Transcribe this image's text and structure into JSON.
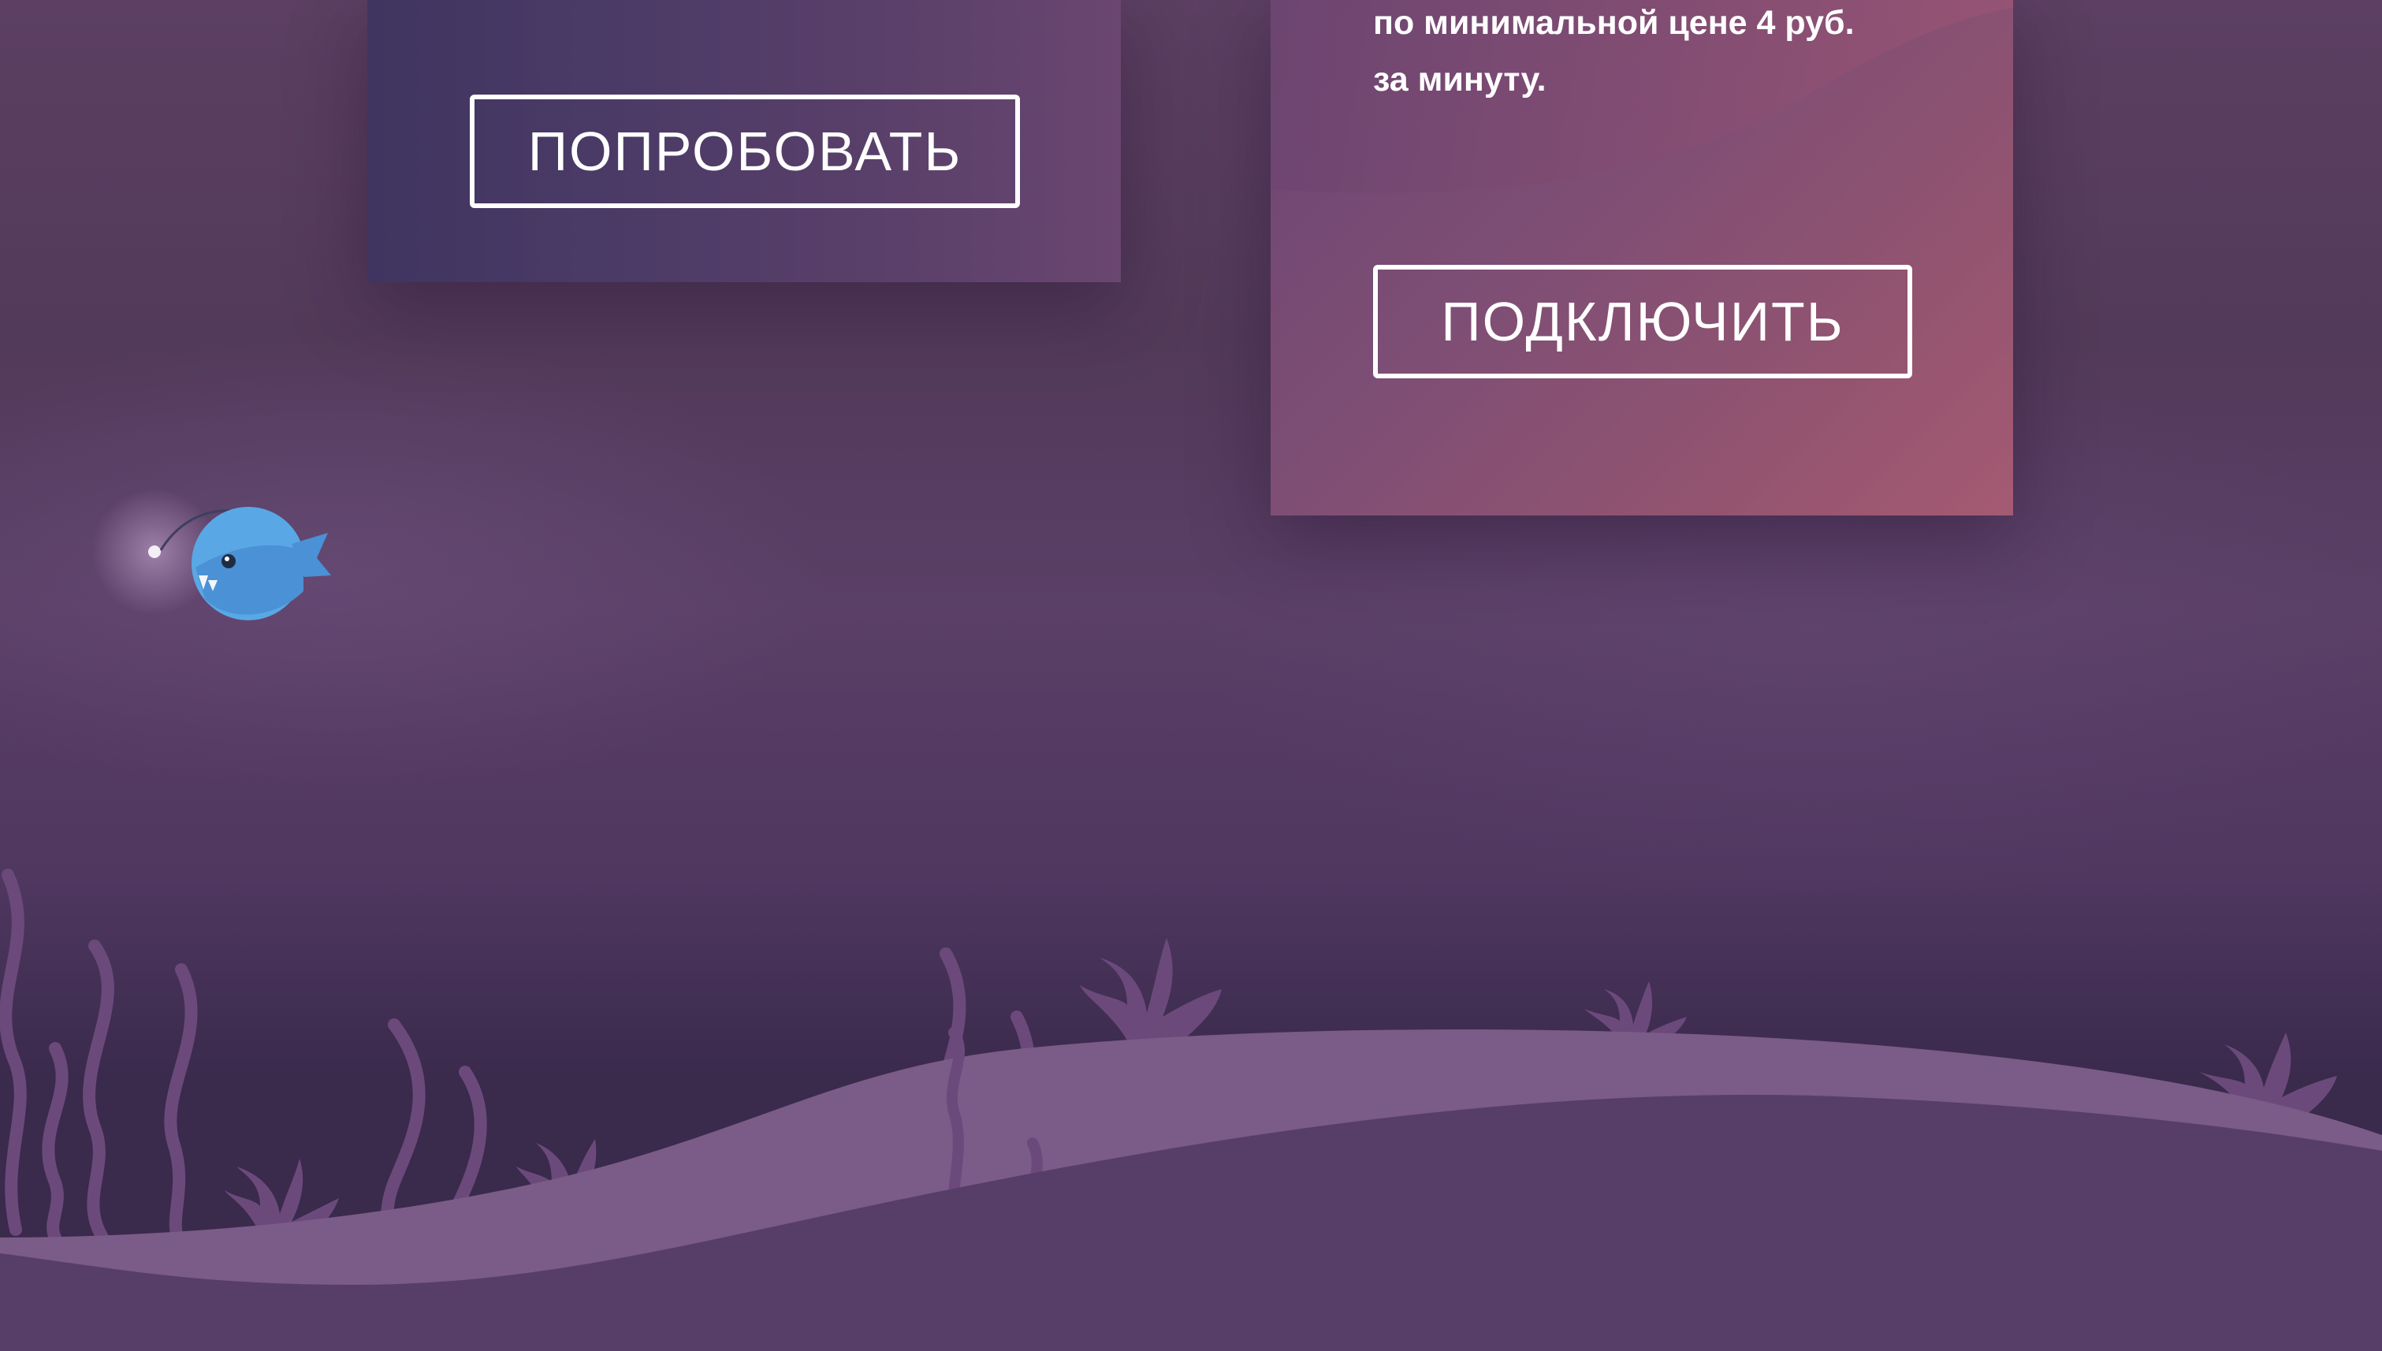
{
  "cards": {
    "try": {
      "button_label": "ПОПРОБОВАТЬ"
    },
    "connect": {
      "text_line_1": "по минимальной цене 4 руб.",
      "text_line_2": "за минуту.",
      "button_label": "ПОДКЛЮЧИТЬ"
    }
  },
  "colors": {
    "button_outline": "#ffffff",
    "fish_body": "#5aa7e6",
    "seabed_light": "#7b5b87",
    "seabed_dark": "#573e68"
  },
  "decor": {
    "fish_icon": "anglerfish-icon",
    "coral_icon": "coral-icon",
    "seaweed_icon": "seaweed-icon"
  }
}
